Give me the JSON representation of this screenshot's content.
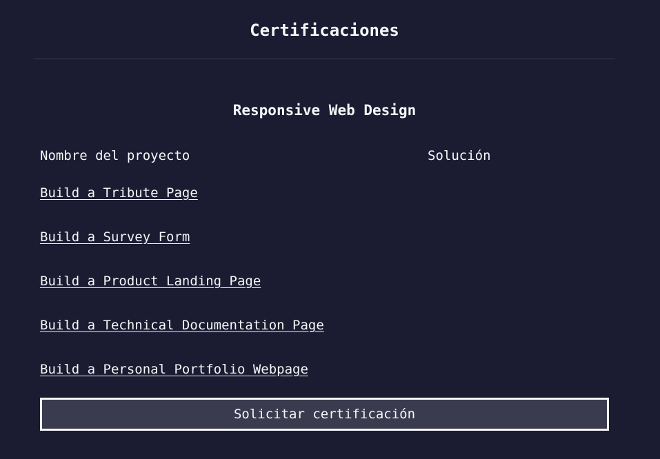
{
  "header": {
    "title": "Certificaciones"
  },
  "certification": {
    "title": "Responsive Web Design",
    "columns": {
      "name": "Nombre del proyecto",
      "solution": "Solución"
    },
    "projects": [
      {
        "name": "Build a Tribute Page"
      },
      {
        "name": "Build a Survey Form"
      },
      {
        "name": "Build a Product Landing Page"
      },
      {
        "name": "Build a Technical Documentation Page"
      },
      {
        "name": "Build a Personal Portfolio Webpage"
      }
    ],
    "claim_button_label": "Solicitar certificación"
  },
  "colors": {
    "background": "#1b1b32",
    "text": "#f5f6f7",
    "button_bg": "#3b3b4f",
    "divider": "#3b3b4f"
  }
}
